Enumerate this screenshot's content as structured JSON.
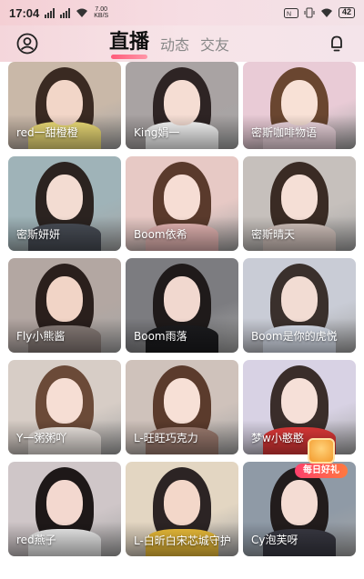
{
  "status_bar": {
    "time": "17:04",
    "speed_value": "7.00",
    "speed_unit": "KB/S",
    "battery": "42"
  },
  "header": {
    "tabs": [
      {
        "label": "直播",
        "active": true
      },
      {
        "label": "动态",
        "active": false
      },
      {
        "label": "交友",
        "active": false
      }
    ]
  },
  "streams": [
    {
      "name": "red一甜橙橙",
      "bg": "#c9b8a8",
      "hair": "#3a2a22",
      "skin": "#f2d6c8",
      "outfit": "#f3e27a"
    },
    {
      "name": "King娟一",
      "bg": "#a9a3a3",
      "hair": "#2e2424",
      "skin": "#f5ddd3",
      "outfit": "#ffffff"
    },
    {
      "name": "密斯咖啡物语",
      "bg": "#e9cbd6",
      "hair": "#6a4630",
      "skin": "#f8e1d6",
      "outfit": "#f1d9e2"
    },
    {
      "name": "密斯妍妍",
      "bg": "#9fb3b8",
      "hair": "#2b2320",
      "skin": "#f3dcd2",
      "outfit": "#4a4f58"
    },
    {
      "name": "Boom依希",
      "bg": "#e7c9c5",
      "hair": "#5a3a2c",
      "skin": "#f6ddd4",
      "outfit": "#e9b8b6"
    },
    {
      "name": "密斯晴天",
      "bg": "#c6c0bc",
      "hair": "#3a2b24",
      "skin": "#f5dfd6",
      "outfit": "#d6c6c0"
    },
    {
      "name": "Fly小熊酱",
      "bg": "#b3a7a2",
      "hair": "#2a1f1c",
      "skin": "#f1d4c6",
      "outfit": "#8a7e7a"
    },
    {
      "name": "Boom雨落",
      "bg": "#7c7c80",
      "hair": "#1f1a1a",
      "skin": "#f1d8cf",
      "outfit": "#1c1c1f"
    },
    {
      "name": "Boom是你的虎悦",
      "bg": "#c9ccd6",
      "hair": "#3a302c",
      "skin": "#f2dcd3",
      "outfit": "#dfe6f3"
    },
    {
      "name": "Y一粥粥吖",
      "bg": "#d7cdc6",
      "hair": "#6b4a38",
      "skin": "#f6ded4",
      "outfit": "#f0e9e4"
    },
    {
      "name": "L-旺旺巧克力",
      "bg": "#cfc2bb",
      "hair": "#5b3b2c",
      "skin": "#f7e0d6",
      "outfit": "#a07e72"
    },
    {
      "name": "梦w小憨憨",
      "bg": "#d8d2e4",
      "hair": "#3a2d2a",
      "skin": "#f6e0d8",
      "outfit": "#e83a3a"
    },
    {
      "name": "red燕子",
      "bg": "#cfc6c8",
      "hair": "#1e1818",
      "skin": "#f3d8cf",
      "outfit": "#f1f1f1"
    },
    {
      "name": "L-白昕白宋芯城守护",
      "bg": "#e3d6c2",
      "hair": "#2c2424",
      "skin": "#f3d7c9",
      "outfit": "#f2c23a"
    },
    {
      "name": "Cy泡芙呀",
      "bg": "#8f9aa6",
      "hair": "#221c1c",
      "skin": "#f4dcd3",
      "outfit": "#3a3a44"
    }
  ],
  "promo": {
    "label": "每日好礼"
  },
  "colors": {
    "accent": "#ff5b7a",
    "header_bg": "#f6dde3"
  }
}
